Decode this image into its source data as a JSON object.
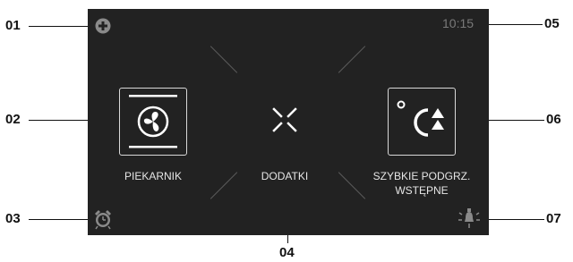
{
  "callouts": [
    "01",
    "02",
    "03",
    "04",
    "05",
    "06",
    "07"
  ],
  "status": {
    "time": "10:15"
  },
  "functions": {
    "oven": {
      "label": "PIEKARNIK",
      "icon": "fan-icon"
    },
    "extras": {
      "label": "DODATKI",
      "icon": "extras-icon"
    },
    "preheat": {
      "label_line1": "SZYBKIE PODGRZ.",
      "label_line2": "WSTĘPNE",
      "icon": "fast-preheat-icon"
    }
  },
  "icons": {
    "top_left": "plus-circle-icon",
    "bottom_left": "alarm-clock-icon",
    "bottom_right": "lamp-icon"
  },
  "colors": {
    "screen": "#222222",
    "text": "#e6e6e6",
    "dim": "#7a7a7a",
    "callout": "#111111"
  }
}
